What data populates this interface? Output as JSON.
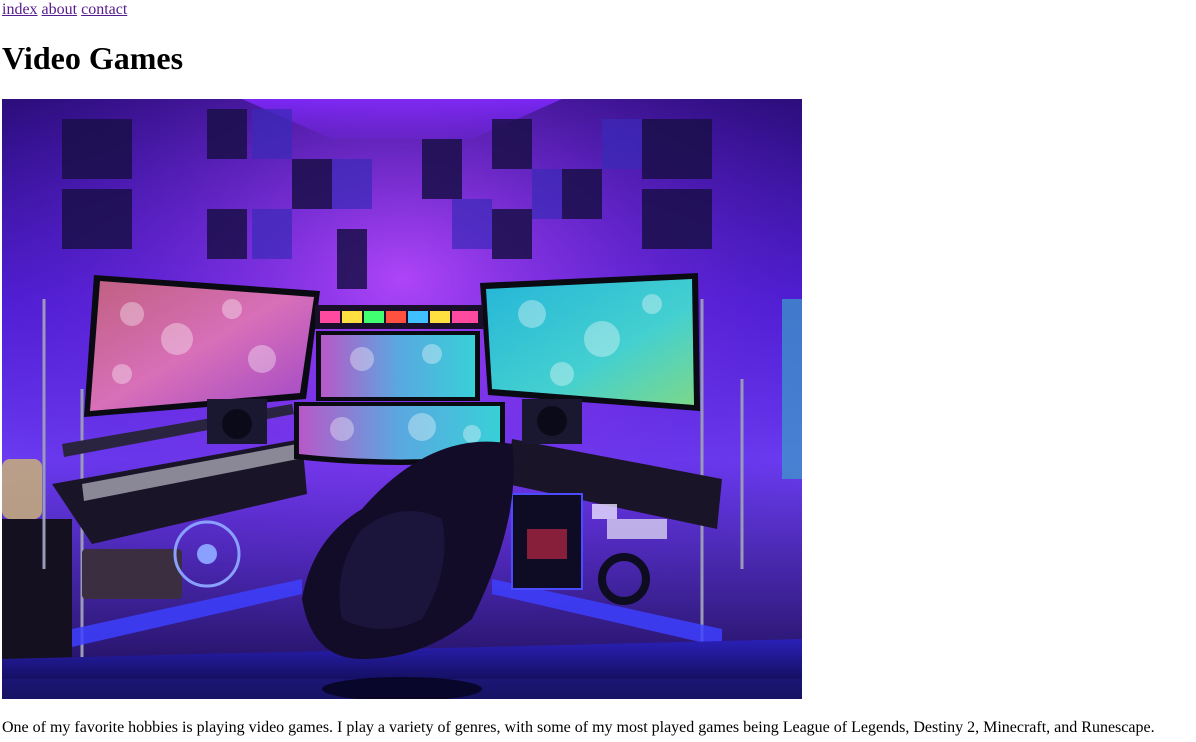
{
  "nav": {
    "links": [
      "index",
      "about",
      "contact"
    ]
  },
  "page": {
    "title": "Video Games",
    "intro": "One of my favorite hobbies is playing video games. I play a variety of genres, with some of my most played games being League of Legends, Destiny 2, Minecraft, and Runescape."
  },
  "colors": {
    "link_visited": "#551a8b",
    "room_purple": "#5a1fd0",
    "led_blue": "#2a2cff"
  }
}
